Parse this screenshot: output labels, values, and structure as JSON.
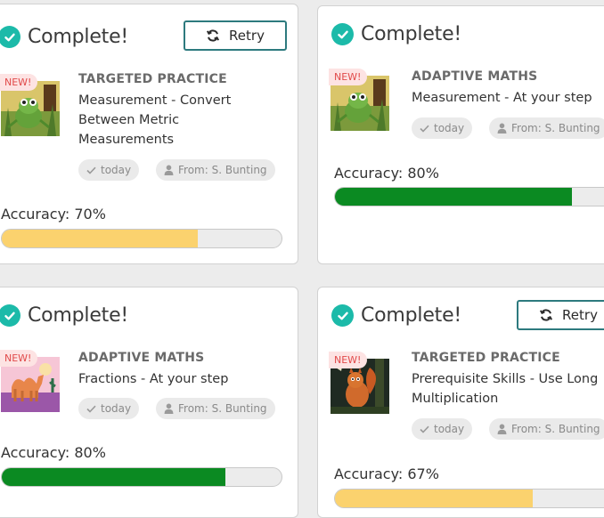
{
  "colors": {
    "check": "#1cbaa9",
    "retry_border": "#2d7a7e",
    "new_badge_bg": "#fde3e3",
    "new_badge_text": "#e14a4a",
    "progress_high": "#0b8a22",
    "progress_low": "#fbd26e",
    "progress_track": "#ececec"
  },
  "cards": [
    {
      "status": "Complete!",
      "check_icon": "check-circle-icon",
      "retry_label": "Retry",
      "retry_icon": "refresh-icon",
      "badge": "NEW!",
      "thumbnail": "frog-thumbnail",
      "category": "TARGETED PRACTICE",
      "title": "Measurement - Convert Between Metric Measurements",
      "date_label": "today",
      "date_icon": "check-icon",
      "from_label": "From: S. Bunting",
      "from_icon": "user-icon",
      "accuracy_label": "Accuracy: 70%",
      "accuracy": 70
    },
    {
      "status": "Complete!",
      "check_icon": "check-circle-icon",
      "badge": "NEW!",
      "thumbnail": "frog-thumbnail",
      "category": "ADAPTIVE MATHS",
      "title": "Measurement - At your step",
      "date_label": "today",
      "date_icon": "check-icon",
      "from_label": "From: S. Bunting",
      "from_icon": "user-icon",
      "accuracy_label": "Accuracy: 80%",
      "accuracy": 80
    },
    {
      "status": "Complete!",
      "check_icon": "check-circle-icon",
      "badge": "NEW!",
      "thumbnail": "camel-thumbnail",
      "category": "ADAPTIVE MATHS",
      "title": "Fractions - At your step",
      "date_label": "today",
      "date_icon": "check-icon",
      "from_label": "From: S. Bunting",
      "from_icon": "user-icon",
      "accuracy_label": "Accuracy: 80%",
      "accuracy": 80
    },
    {
      "status": "Complete!",
      "check_icon": "check-circle-icon",
      "retry_label": "Retry",
      "retry_icon": "refresh-icon",
      "badge": "NEW!",
      "thumbnail": "squirrel-thumbnail",
      "category": "TARGETED PRACTICE",
      "title": "Prerequisite Skills - Use Long Multiplication",
      "date_label": "today",
      "date_icon": "check-icon",
      "from_label": "From: S. Bunting",
      "from_icon": "user-icon",
      "accuracy_label": "Accuracy: 67%",
      "accuracy": 67
    }
  ]
}
